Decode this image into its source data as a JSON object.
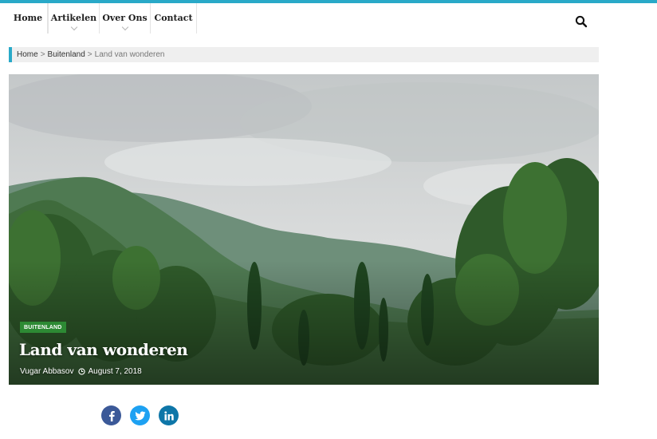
{
  "nav": {
    "items": [
      {
        "label": "Home",
        "has_submenu": false
      },
      {
        "label": "Artikelen",
        "has_submenu": true
      },
      {
        "label": "Over Ons",
        "has_submenu": true
      },
      {
        "label": "Contact",
        "has_submenu": false
      }
    ],
    "search_icon": "search-icon"
  },
  "breadcrumb": {
    "home": "Home",
    "separator": ">",
    "category": "Buitenland",
    "current": "Land van wonderen"
  },
  "post": {
    "category_badge": "BUITENLAND",
    "title": "Land van wonderen",
    "author": "Vugar Abbasov",
    "date": "August 7, 2018",
    "image_alt": "Green mountain landscape with cypress trees under a cloudy sky"
  },
  "share": {
    "icons": [
      "facebook-icon",
      "twitter-icon",
      "linkedin-icon"
    ]
  },
  "colors": {
    "accent": "#29a9c8",
    "badge": "#2d8a34",
    "facebook": "#3b5998",
    "twitter": "#1da1f2",
    "linkedin": "#0e76a8"
  }
}
